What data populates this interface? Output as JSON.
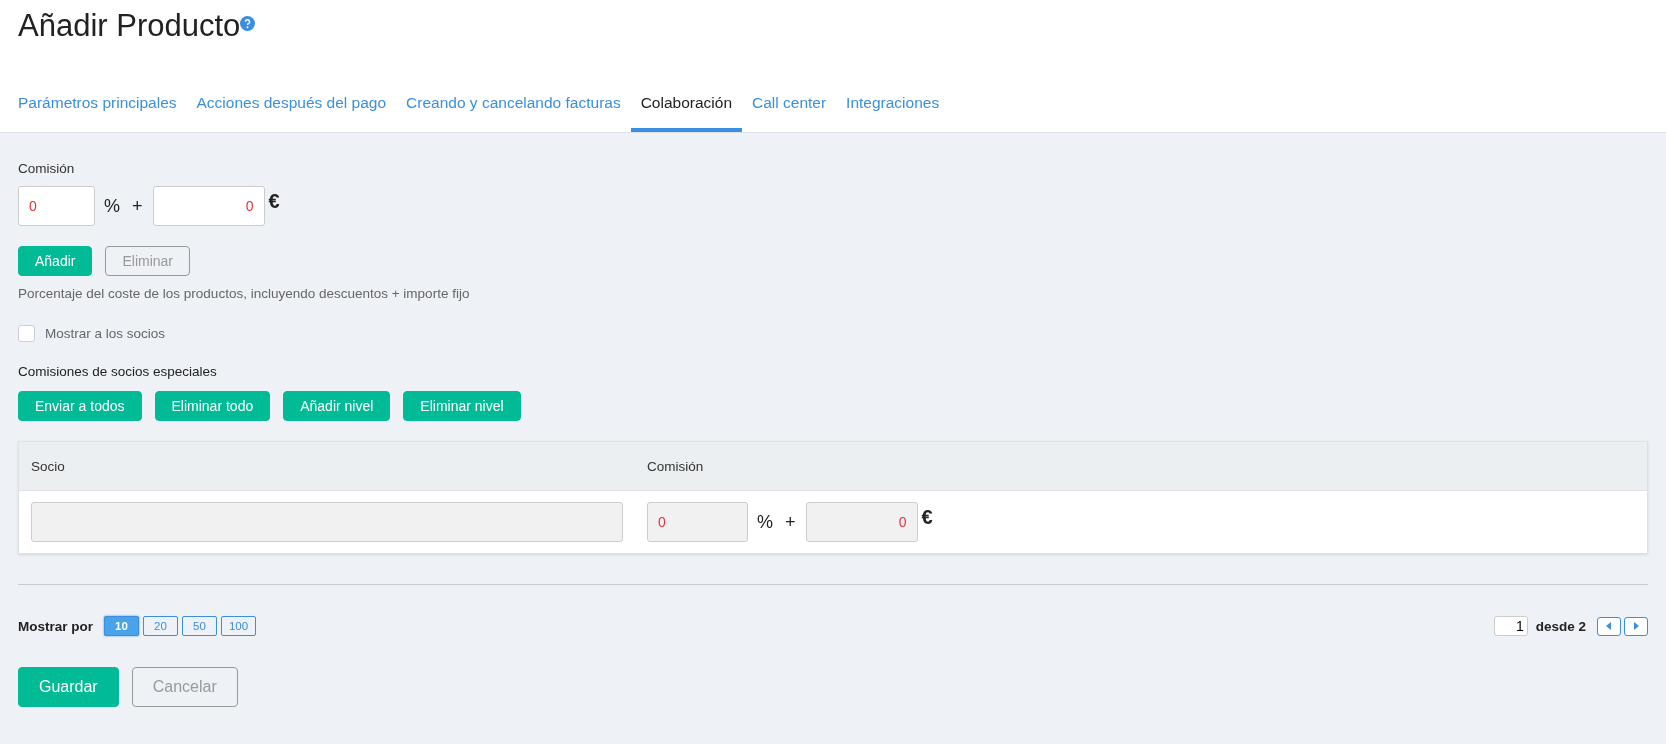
{
  "title": "Añadir Producto",
  "tabs": [
    {
      "label": "Parámetros principales",
      "selected": false
    },
    {
      "label": "Acciones después del pago",
      "selected": false
    },
    {
      "label": "Creando y cancelando facturas",
      "selected": false
    },
    {
      "label": "Colaboración",
      "selected": true
    },
    {
      "label": "Call center",
      "selected": false
    },
    {
      "label": "Integraciones",
      "selected": false
    }
  ],
  "commission": {
    "label": "Comisión",
    "percent_value": "0",
    "percent_sign": "%",
    "plus": "+",
    "fixed_value": "0",
    "currency": "€"
  },
  "commission_buttons": [
    {
      "label": "Añadir",
      "disabled": false
    },
    {
      "label": "Eliminar",
      "disabled": true
    }
  ],
  "hint": "Porcentaje del coste de los productos, incluyendo descuentos + importe fijo",
  "show_partners": {
    "label": "Mostrar a los socios",
    "checked": false
  },
  "special_label": "Comisiones de socios especiales",
  "special_buttons": [
    "Enviar a todos",
    "Eliminar todo",
    "Añadir nivel",
    "Eliminar nivel"
  ],
  "table": {
    "columns": [
      "Socio",
      "Comisión"
    ],
    "rows": [
      {
        "partner": "",
        "percent_value": "0",
        "percent_sign": "%",
        "plus": "+",
        "fixed_value": "0",
        "currency": "€"
      }
    ]
  },
  "pagination": {
    "label": "Mostrar por",
    "page_sizes": [
      {
        "label": "10",
        "selected": true
      },
      {
        "label": "20",
        "selected": false
      },
      {
        "label": "50",
        "selected": false
      },
      {
        "label": "100",
        "selected": false
      }
    ],
    "page": "1",
    "of": "desde 2"
  },
  "footer_buttons": [
    {
      "label": "Guardar",
      "disabled": false
    },
    {
      "label": "Cancelar",
      "disabled": true
    }
  ]
}
